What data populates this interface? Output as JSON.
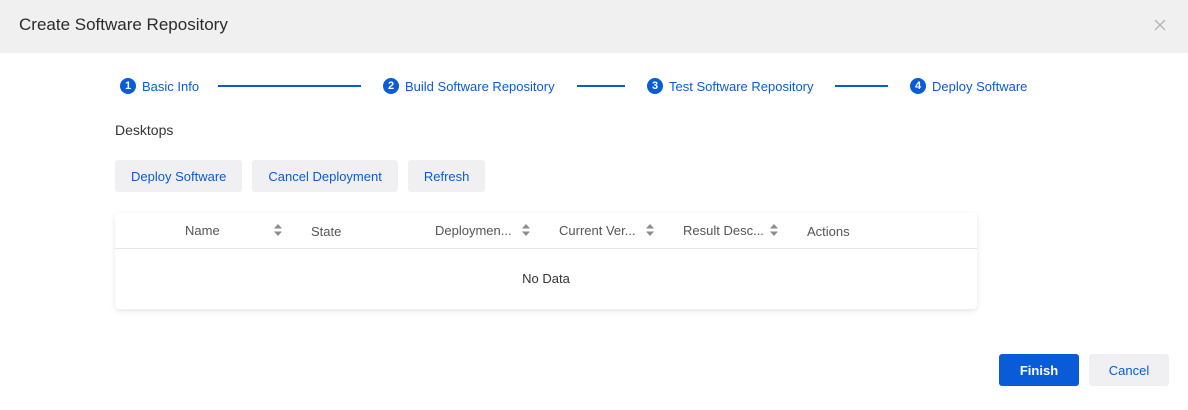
{
  "dialog": {
    "title": "Create Software Repository"
  },
  "steps": [
    {
      "number": "1",
      "label": "Basic Info"
    },
    {
      "number": "2",
      "label": "Build Software Repository"
    },
    {
      "number": "3",
      "label": "Test Software Repository"
    },
    {
      "number": "4",
      "label": "Deploy Software"
    }
  ],
  "section": {
    "title": "Desktops"
  },
  "toolbar": {
    "deploy_label": "Deploy Software",
    "cancel_deployment_label": "Cancel Deployment",
    "refresh_label": "Refresh"
  },
  "table": {
    "columns": [
      "Name",
      "State",
      "Deploymen...",
      "Current Ver...",
      "Result Desc...",
      "Actions"
    ],
    "empty_text": "No Data"
  },
  "footer": {
    "finish_label": "Finish",
    "cancel_label": "Cancel"
  },
  "colors": {
    "accent": "#0a5bd8",
    "header_bg": "#f0f0f0",
    "button_bg": "#f0f0f2"
  }
}
